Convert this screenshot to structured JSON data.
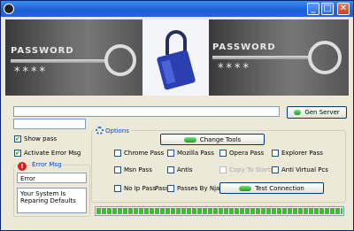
{
  "window": {
    "title": "",
    "minimize": "_",
    "maximize": "□",
    "close": "✕"
  },
  "banner": {
    "left_label": "PASSWORD",
    "left_stars": "****",
    "right_label": "PASSWORD",
    "right_stars": "****"
  },
  "inputs": {
    "main_field": "",
    "small_field": ""
  },
  "buttons": {
    "gen_server": "Gen Server",
    "change_tools": "Change Tools",
    "test_connection": "Test Connection"
  },
  "left_options": {
    "show_pass": {
      "label": "Show pass",
      "checked": true
    },
    "activate_error": {
      "label": "Activate Error Msg",
      "checked": true
    }
  },
  "error_msg": {
    "legend": "Error Msg",
    "title_value": "Error",
    "body_value": "Your System Is Reparing Defaults"
  },
  "options": {
    "legend": "Options",
    "checkboxes": [
      {
        "label": "Chrome Pass",
        "checked": false,
        "enabled": true
      },
      {
        "label": "Mozilla Pass",
        "checked": false,
        "enabled": true
      },
      {
        "label": "Opera Pass",
        "checked": false,
        "enabled": true
      },
      {
        "label": "Explorer Pass",
        "checked": false,
        "enabled": true
      },
      {
        "label": "Msn Pass",
        "checked": false,
        "enabled": true
      },
      {
        "label": "Antis",
        "checked": false,
        "enabled": true
      },
      {
        "label": "Copy To Startup",
        "checked": false,
        "enabled": false
      },
      {
        "label": "Anti Virtual Pcs",
        "checked": false,
        "enabled": true
      },
      {
        "label": "No Ip Pass",
        "checked": false,
        "enabled": true
      },
      {
        "label": "Pass",
        "checked": false,
        "enabled": true
      },
      {
        "label": "Passes By Nja8",
        "checked": false,
        "enabled": true
      }
    ]
  },
  "progress": {
    "value": 1.0
  },
  "colors": {
    "title_bar": "#2165dd",
    "accent": "#0046d5",
    "progress": "#2fc42f",
    "error": "#d81e1e"
  }
}
